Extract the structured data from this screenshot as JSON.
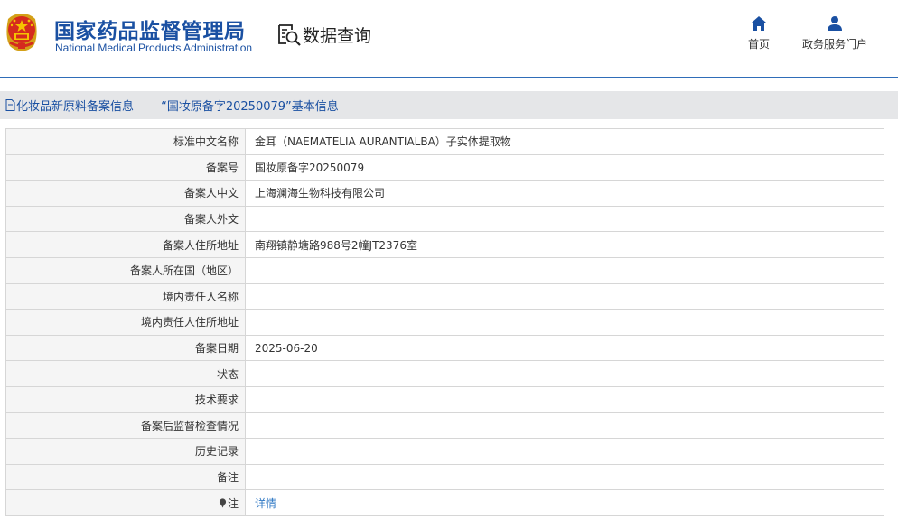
{
  "header": {
    "org_name_cn": "国家药品监督管理局",
    "org_name_en": "National Medical Products Administration",
    "query_label": "数据查询",
    "nav": [
      {
        "label": "首页",
        "icon": "home-icon"
      },
      {
        "label": "政务服务门户",
        "icon": "user-icon"
      }
    ]
  },
  "title_bar": {
    "text": "化妆品新原料备案信息 ——“国妆原备字20250079”基本信息",
    "icon": "document-icon"
  },
  "table": {
    "rows": [
      {
        "label": "标准中文名称",
        "value": "金耳（NAEMATELIA AURANTIALBA）子实体提取物"
      },
      {
        "label": "备案号",
        "value": "国妆原备字20250079"
      },
      {
        "label": "备案人中文",
        "value": "上海澜海生物科技有限公司"
      },
      {
        "label": "备案人外文",
        "value": ""
      },
      {
        "label": "备案人住所地址",
        "value": "南翔镇静塘路988号2幢JT2376室"
      },
      {
        "label": "备案人所在国（地区）",
        "value": ""
      },
      {
        "label": "境内责任人名称",
        "value": ""
      },
      {
        "label": "境内责任人住所地址",
        "value": ""
      },
      {
        "label": "备案日期",
        "value": "2025-06-20"
      },
      {
        "label": "状态",
        "value": ""
      },
      {
        "label": "技术要求",
        "value": ""
      },
      {
        "label": "备案后监督检查情况",
        "value": ""
      },
      {
        "label": "历史记录",
        "value": ""
      },
      {
        "label": "备注",
        "value": ""
      }
    ],
    "note_row": {
      "label": "注",
      "icon": "pin-icon",
      "link_text": "详情"
    }
  },
  "colors": {
    "brand_blue": "#1a50a2",
    "link_blue": "#2f78c4",
    "title_bar_bg": "#e5e6e8",
    "label_cell_bg": "#f5f5f5",
    "border": "#d6d6d6"
  }
}
